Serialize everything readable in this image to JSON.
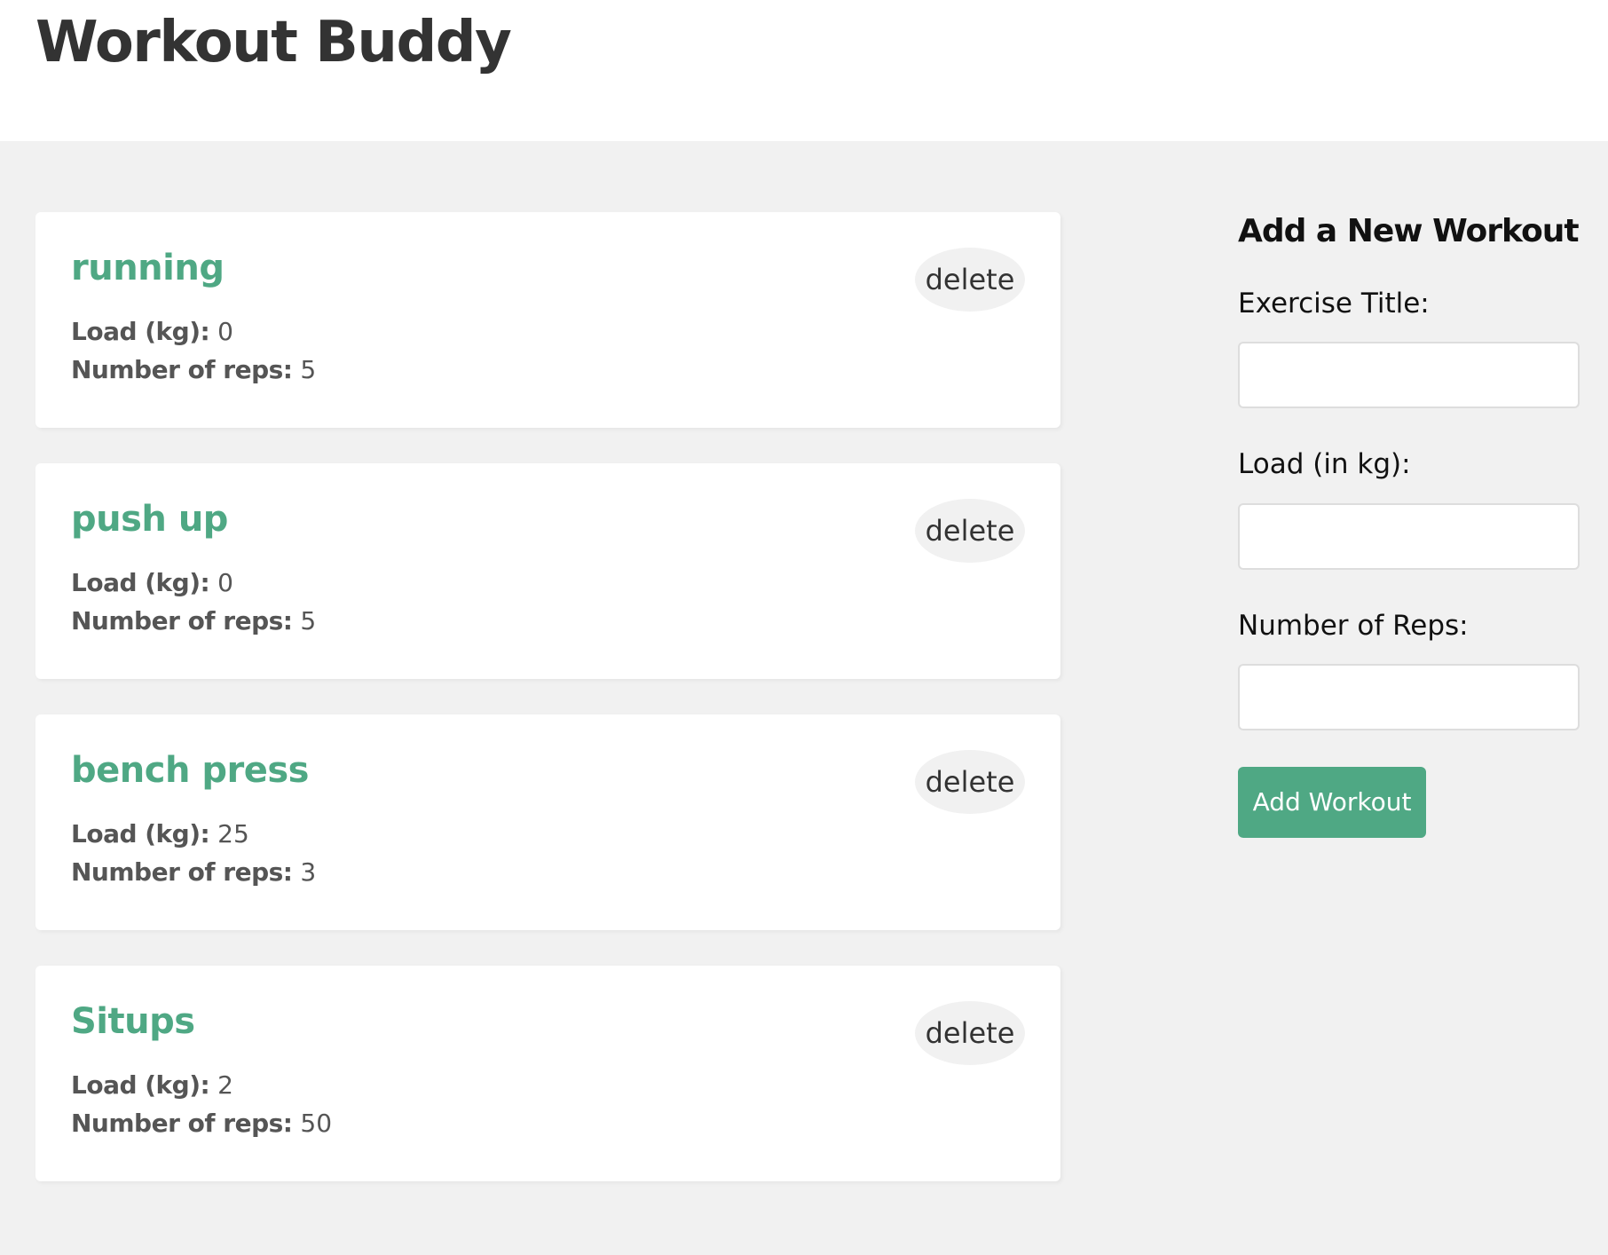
{
  "header": {
    "title": "Workout Buddy"
  },
  "workouts": [
    {
      "title": "running",
      "load_label": "Load (kg):",
      "load": "0",
      "reps_label": "Number of reps:",
      "reps": "5",
      "delete_label": "delete"
    },
    {
      "title": "push up",
      "load_label": "Load (kg):",
      "load": "0",
      "reps_label": "Number of reps:",
      "reps": "5",
      "delete_label": "delete"
    },
    {
      "title": "bench press",
      "load_label": "Load (kg):",
      "load": "25",
      "reps_label": "Number of reps:",
      "reps": "3",
      "delete_label": "delete"
    },
    {
      "title": "Situps",
      "load_label": "Load (kg):",
      "load": "2",
      "reps_label": "Number of reps:",
      "reps": "50",
      "delete_label": "delete"
    }
  ],
  "form": {
    "heading": "Add a New Workout",
    "title_label": "Exercise Title:",
    "title_value": "",
    "load_label": "Load (in kg):",
    "load_value": "",
    "reps_label": "Number of Reps:",
    "reps_value": "",
    "submit_label": "Add Workout"
  },
  "colors": {
    "accent": "#4fa884",
    "background": "#f1f1f1",
    "card": "#ffffff",
    "text": "#333333"
  }
}
